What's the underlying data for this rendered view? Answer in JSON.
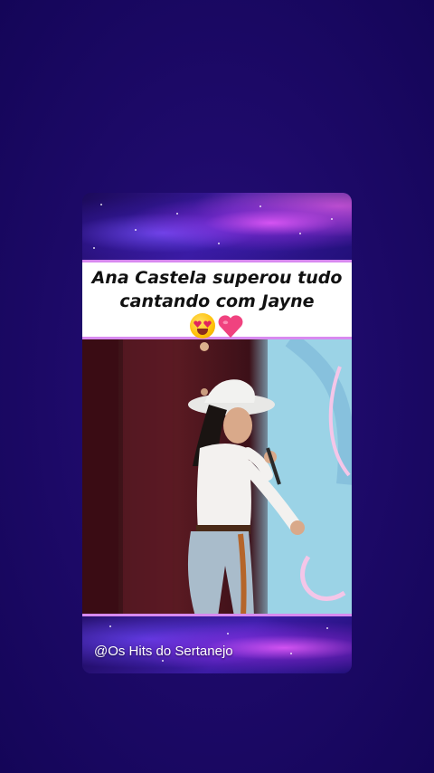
{
  "post": {
    "headline": "Ana Castela superou tudo cantando com Jayne",
    "emojis": [
      "smiling-face-with-heart-eyes",
      "pink-heart"
    ],
    "watermark": "@Os Hits do Sertanejo"
  },
  "colors": {
    "background": "#1e0a6a",
    "accent_border": "#d88af0",
    "headline_bg": "#ffffff",
    "headline_text": "#111111"
  }
}
